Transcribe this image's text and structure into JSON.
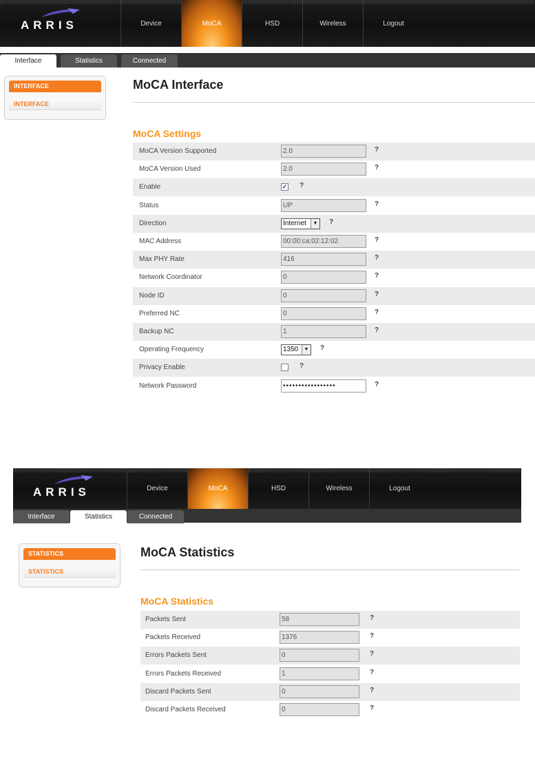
{
  "brand": {
    "logo_text": "ARRIS",
    "accent": "#f7941d"
  },
  "nav": {
    "items": [
      "Device",
      "MoCA",
      "HSD",
      "Wireless",
      "Logout"
    ],
    "active": "MoCA"
  },
  "tabs": {
    "items": [
      "Interface",
      "Statistics",
      "Connected"
    ]
  },
  "interface_page": {
    "active_tab": "Interface",
    "sidebar": {
      "heading": "INTERFACE",
      "item": "INTERFACE"
    },
    "title": "MoCA Interface",
    "section": "MoCA Settings",
    "rows": [
      {
        "label": "MoCA Version Supported",
        "value": "2.0"
      },
      {
        "label": "MoCA Version Used",
        "value": "2.0"
      },
      {
        "label": "Enable",
        "checked_mark": "✓"
      },
      {
        "label": "Status",
        "value": "UP"
      },
      {
        "label": "Direction",
        "selected": "Internet"
      },
      {
        "label": "MAC Address",
        "value": "00:00:ca:02:12:02"
      },
      {
        "label": "Max PHY Rate",
        "value": "416"
      },
      {
        "label": "Network Coordinator",
        "value": "0"
      },
      {
        "label": "Node ID",
        "value": "0"
      },
      {
        "label": "Preferred NC",
        "value": "0"
      },
      {
        "label": "Backup NC",
        "value": "1"
      },
      {
        "label": "Operating Frequency",
        "selected": "1350"
      },
      {
        "label": "Privacy Enable",
        "checked_mark": ""
      },
      {
        "label": "Network Password",
        "value": "•••••••••••••••••"
      }
    ]
  },
  "statistics_page": {
    "active_tab": "Statistics",
    "sidebar": {
      "heading": "STATISTICS",
      "item": "STATISTICS"
    },
    "title": "MoCA Statistics",
    "section": "MoCA Statistics",
    "rows": [
      {
        "label": "Packets Sent",
        "value": "58"
      },
      {
        "label": "Packets Received",
        "value": "1376"
      },
      {
        "label": "Errors Packets Sent",
        "value": "0"
      },
      {
        "label": "Errors Packets Received",
        "value": "1"
      },
      {
        "label": "Discard Packets Sent",
        "value": "0"
      },
      {
        "label": "Discard Packets Received",
        "value": "0"
      }
    ]
  },
  "help_glyph": "?",
  "select_arrow": "▼"
}
